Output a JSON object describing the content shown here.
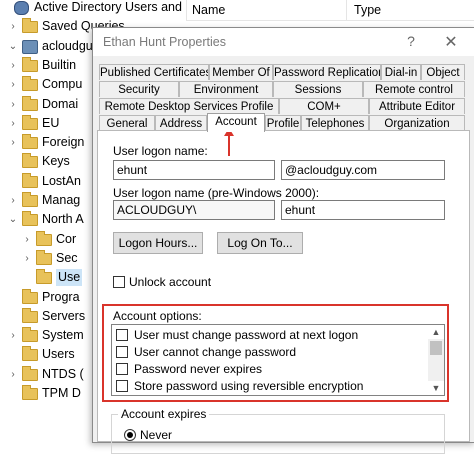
{
  "tree": {
    "items": [
      {
        "label": "Active Directory Users and Com",
        "icon": "ad-icon",
        "expander": "",
        "indent": 0
      },
      {
        "label": "Saved Queries",
        "icon": "folder-icon",
        "expander": "›",
        "indent": 1
      },
      {
        "label": "acloudguy",
        "icon": "domain-icon",
        "expander": "⌄",
        "indent": 1
      },
      {
        "label": "Builtin",
        "icon": "folder-icon",
        "expander": "›",
        "indent": 2
      },
      {
        "label": "Compu",
        "icon": "folder-icon",
        "expander": "›",
        "indent": 2
      },
      {
        "label": "Domai",
        "icon": "folder-icon",
        "expander": "›",
        "indent": 2
      },
      {
        "label": "EU",
        "icon": "folder-icon",
        "expander": "›",
        "indent": 2
      },
      {
        "label": "Foreign",
        "icon": "folder-icon",
        "expander": "›",
        "indent": 2
      },
      {
        "label": "Keys",
        "icon": "folder-icon",
        "expander": "",
        "indent": 2
      },
      {
        "label": "LostAn",
        "icon": "folder-icon",
        "expander": "",
        "indent": 2
      },
      {
        "label": "Manag",
        "icon": "folder-icon",
        "expander": "›",
        "indent": 2
      },
      {
        "label": "North A",
        "icon": "folder-icon",
        "expander": "⌄",
        "indent": 2
      },
      {
        "label": "Cor",
        "icon": "folder-icon",
        "expander": "›",
        "indent": 3
      },
      {
        "label": "Sec",
        "icon": "folder-icon",
        "expander": "›",
        "indent": 3
      },
      {
        "label": "Use",
        "icon": "folder-icon",
        "expander": "",
        "indent": 3,
        "selected": true
      },
      {
        "label": "Progra",
        "icon": "folder-icon",
        "expander": "",
        "indent": 2
      },
      {
        "label": "Servers",
        "icon": "folder-icon",
        "expander": "",
        "indent": 2
      },
      {
        "label": "System",
        "icon": "folder-icon",
        "expander": "›",
        "indent": 2
      },
      {
        "label": "Users",
        "icon": "folder-icon",
        "expander": "",
        "indent": 2
      },
      {
        "label": "NTDS (",
        "icon": "folder-icon",
        "expander": "›",
        "indent": 2
      },
      {
        "label": "TPM D",
        "icon": "folder-icon",
        "expander": "",
        "indent": 2
      }
    ]
  },
  "list_header": {
    "name": "Name",
    "type": "Type"
  },
  "dialog": {
    "title": "Ethan Hunt Properties",
    "help": "?",
    "close": "✕",
    "tab_rows": [
      [
        {
          "label": "Published Certificates"
        },
        {
          "label": "Member Of"
        },
        {
          "label": "Password Replication"
        },
        {
          "label": "Dial-in"
        },
        {
          "label": "Object"
        }
      ],
      [
        {
          "label": "Security"
        },
        {
          "label": "Environment"
        },
        {
          "label": "Sessions"
        },
        {
          "label": "Remote control"
        }
      ],
      [
        {
          "label": "Remote Desktop Services Profile"
        },
        {
          "label": "COM+"
        },
        {
          "label": "Attribute Editor"
        }
      ],
      [
        {
          "label": "General"
        },
        {
          "label": "Address"
        },
        {
          "label": "Account",
          "active": true
        },
        {
          "label": "Profile"
        },
        {
          "label": "Telephones"
        },
        {
          "label": "Organization"
        }
      ]
    ],
    "account": {
      "logon_name_label": "User logon name:",
      "logon_name_value": "ehunt",
      "upn_suffix": "@acloudguy.com",
      "pre2000_label": "User logon name (pre-Windows 2000):",
      "pre2000_domain": "ACLOUDGUY\\",
      "pre2000_name": "ehunt",
      "logon_hours_button": "Logon Hours...",
      "logon_to_button": "Log On To...",
      "unlock_label": "Unlock account",
      "options_label": "Account options:",
      "options": [
        {
          "label": "User must change password at next logon",
          "checked": false
        },
        {
          "label": "User cannot change password",
          "checked": false
        },
        {
          "label": "Password never expires",
          "checked": false
        },
        {
          "label": "Store password using reversible encryption",
          "checked": false
        }
      ],
      "expires_label": "Account expires",
      "never_label": "Never"
    }
  },
  "colors": {
    "annotation": "#d9342b",
    "selection": "#cce4f7"
  }
}
